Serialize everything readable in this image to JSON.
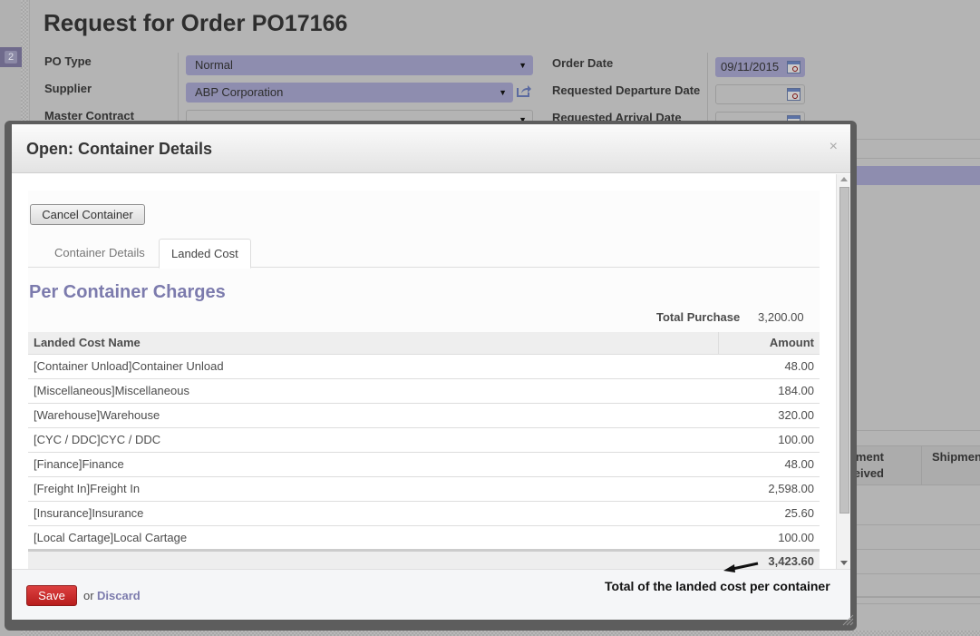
{
  "background": {
    "sidebar_badge": "2",
    "title": "Request for Order",
    "po_number": "PO17166",
    "fields": {
      "po_type": {
        "label": "PO Type",
        "value": "Normal"
      },
      "supplier": {
        "label": "Supplier",
        "value": "ABP Corporation"
      },
      "master_contract": {
        "label": "Master Contract",
        "value": ""
      },
      "order_date": {
        "label": "Order Date",
        "value": "09/11/2015"
      },
      "requested_departure_date": {
        "label": "Requested Departure Date",
        "value": ""
      },
      "requested_arrival_date": {
        "label": "Requested Arrival Date",
        "value": ""
      }
    },
    "table_headers": [
      "...ment\n...ived",
      "Shipmen..."
    ]
  },
  "modal": {
    "title": "Open: Container Details",
    "close_glyph": "×",
    "cancel_container_label": "Cancel Container",
    "tabs": [
      {
        "label": "Container Details",
        "active": false
      },
      {
        "label": "Landed Cost",
        "active": true
      }
    ],
    "section_title": "Per Container Charges",
    "total_purchase_label": "Total Purchase",
    "total_purchase_value": "3,200.00",
    "table": {
      "columns": [
        "Landed Cost Name",
        "Amount"
      ],
      "rows": [
        {
          "name": "[Container Unload]Container Unload",
          "amount": "48.00"
        },
        {
          "name": "[Miscellaneous]Miscellaneous",
          "amount": "184.00"
        },
        {
          "name": "[Warehouse]Warehouse",
          "amount": "320.00"
        },
        {
          "name": "[CYC / DDC]CYC / DDC",
          "amount": "100.00"
        },
        {
          "name": "[Finance]Finance",
          "amount": "48.00"
        },
        {
          "name": "[Freight In]Freight In",
          "amount": "2,598.00"
        },
        {
          "name": "[Insurance]Insurance",
          "amount": "25.60"
        },
        {
          "name": "[Local Cartage]Local Cartage",
          "amount": "100.00"
        }
      ],
      "total": "3,423.60"
    },
    "footer": {
      "save_label": "Save",
      "or_text": "or",
      "discard_label": "Discard",
      "annotation": "Total of the landed cost per container"
    }
  },
  "colors": {
    "accent_purple": "#7c7bad",
    "save_red": "#c62828",
    "field_highlight": "#8e8daf"
  }
}
